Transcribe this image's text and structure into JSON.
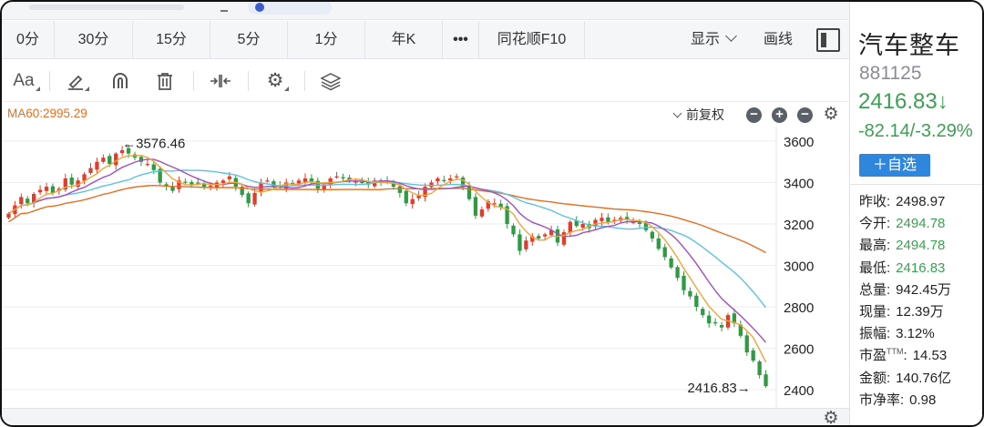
{
  "periods": [
    "0分",
    "30分",
    "15分",
    "5分",
    "1分",
    "年K",
    "•••",
    "同花顺F10"
  ],
  "toolbar": {
    "display_label": "显示",
    "draw_label": "画线",
    "tools": [
      "Aa",
      "pen-icon",
      "magnet-icon",
      "trash-icon",
      "adjust-width-icon",
      "gear-icon",
      "layers-icon"
    ]
  },
  "chart_header": {
    "ma60": "MA60:2995.29",
    "adjust_label": "前复权"
  },
  "chart_data": {
    "type": "candlestick",
    "y_ticks": [
      "3600",
      "3400",
      "3200",
      "3000",
      "2800",
      "2600",
      "2400"
    ],
    "ylim": [
      2375,
      3640
    ],
    "high_annotation": "←3576.46",
    "low_annotation": "2416.83→",
    "high_value": 3576.46,
    "low_value": 2416.83,
    "colors": {
      "up": "#e23c2c",
      "down": "#2f9a43",
      "ma5": "#f2a43a",
      "ma10": "#a34fbe",
      "ma20": "#5bc4dd",
      "ma60": "#e86d1f"
    },
    "closes": [
      3250,
      3290,
      3330,
      3300,
      3345,
      3365,
      3380,
      3350,
      3370,
      3420,
      3390,
      3410,
      3440,
      3470,
      3500,
      3520,
      3490,
      3540,
      3556,
      3540,
      3520,
      3500,
      3490,
      3460,
      3400,
      3380,
      3360,
      3410,
      3400,
      3390,
      3395,
      3380,
      3385,
      3400,
      3410,
      3430,
      3380,
      3340,
      3300,
      3350,
      3400,
      3410,
      3380,
      3380,
      3400,
      3390,
      3410,
      3420,
      3400,
      3370,
      3390,
      3420,
      3430,
      3420,
      3410,
      3405,
      3400,
      3390,
      3410,
      3400,
      3400,
      3380,
      3350,
      3300,
      3320,
      3340,
      3380,
      3400,
      3420,
      3410,
      3420,
      3430,
      3380,
      3320,
      3240,
      3270,
      3310,
      3300,
      3280,
      3200,
      3150,
      3070,
      3120,
      3140,
      3130,
      3150,
      3170,
      3110,
      3160,
      3210,
      3190,
      3200,
      3180,
      3220,
      3230,
      3210,
      3220,
      3230,
      3220,
      3210,
      3200,
      3170,
      3130,
      3080,
      3040,
      2990,
      2940,
      2880,
      2850,
      2800,
      2760,
      2720,
      2720,
      2700,
      2760,
      2720,
      2660,
      2580,
      2540,
      2470,
      2417
    ]
  },
  "bottom_gear": "gear-icon",
  "quote": {
    "name": "汽车整车",
    "code": "881125",
    "price": "2416.83↓",
    "change": "-82.14/-3.29%",
    "add_button": "＋自选",
    "stats": [
      {
        "label": "昨收:",
        "value": "2498.97",
        "color": "normal"
      },
      {
        "label": "今开:",
        "value": "2494.78",
        "color": "green"
      },
      {
        "label": "最高:",
        "value": "2494.78",
        "color": "green"
      },
      {
        "label": "最低:",
        "value": "2416.83",
        "color": "green"
      },
      {
        "label": "总量:",
        "value": "942.45万",
        "color": "normal"
      },
      {
        "label": "现量:",
        "value": "12.39万",
        "color": "normal"
      },
      {
        "label": "振幅:",
        "value": "3.12%",
        "color": "normal"
      },
      {
        "label": "市盈TTM:",
        "value": "14.53",
        "color": "normal"
      },
      {
        "label": "金额:",
        "value": "140.76亿",
        "color": "normal"
      },
      {
        "label": "市净率:",
        "value": "0.98",
        "color": "normal"
      }
    ]
  }
}
